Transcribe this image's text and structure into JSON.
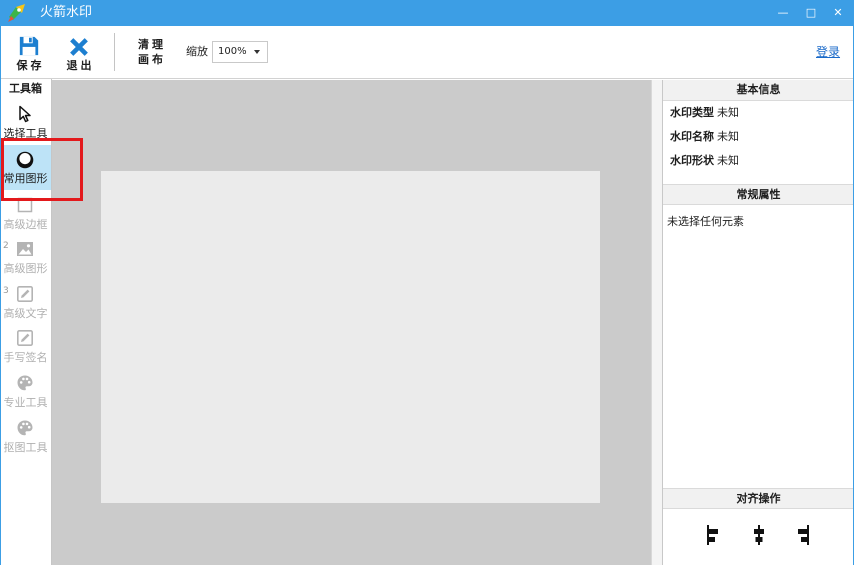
{
  "window": {
    "title": "火箭水印",
    "icon": "rocket-app-icon",
    "controls": {
      "minimize": "—",
      "maximize": "□",
      "close": "✕"
    }
  },
  "toolbar": {
    "save": {
      "label": "保存",
      "icon": "floppy-disk-icon"
    },
    "exit": {
      "label": "退出",
      "icon": "close-x-icon"
    },
    "clear_canvas": {
      "line1": "清理",
      "line2": "画布"
    },
    "zoom": {
      "label": "缩放",
      "value": "100%"
    },
    "login_label": "登录"
  },
  "toolbox": {
    "title": "工具箱",
    "items": [
      {
        "label": "选择工具",
        "icon": "cursor-icon",
        "enabled": true,
        "selected": false
      },
      {
        "label": "常用图形",
        "icon": "shape-circle-icon",
        "enabled": true,
        "selected": true
      },
      {
        "label": "高级边框",
        "icon": "border-square-icon",
        "enabled": false,
        "selected": false
      },
      {
        "label": "高级图形",
        "icon": "image-icon",
        "enabled": false,
        "selected": false,
        "badge": "2"
      },
      {
        "label": "高级文字",
        "icon": "text-edit-icon",
        "enabled": false,
        "selected": false,
        "badge": "3"
      },
      {
        "label": "手写签名",
        "icon": "signature-pen-icon",
        "enabled": false,
        "selected": false
      },
      {
        "label": "专业工具",
        "icon": "palette-icon",
        "enabled": false,
        "selected": false
      },
      {
        "label": "抠图工具",
        "icon": "palette-icon",
        "enabled": false,
        "selected": false
      }
    ]
  },
  "properties": {
    "basic_title": "基本信息",
    "fields": [
      {
        "label": "水印类型",
        "value": "未知"
      },
      {
        "label": "水印名称",
        "value": "未知"
      },
      {
        "label": "水印形状",
        "value": "未知"
      }
    ],
    "general_title": "常规属性",
    "general_empty": "未选择任何元素",
    "align_title": "对齐操作",
    "align_icons": [
      "align-left-icon",
      "align-center-icon",
      "align-right-icon"
    ]
  },
  "colors": {
    "accent": "#3c9ee5",
    "icon_blue": "#1d7fd0",
    "selected_bg": "#bde3f7",
    "disabled_text": "#b0b0b0",
    "link": "#1a6ac9",
    "canvas_bg": "#cbcbcb",
    "page_bg": "#ebebeb",
    "highlight": "#e3191c"
  }
}
